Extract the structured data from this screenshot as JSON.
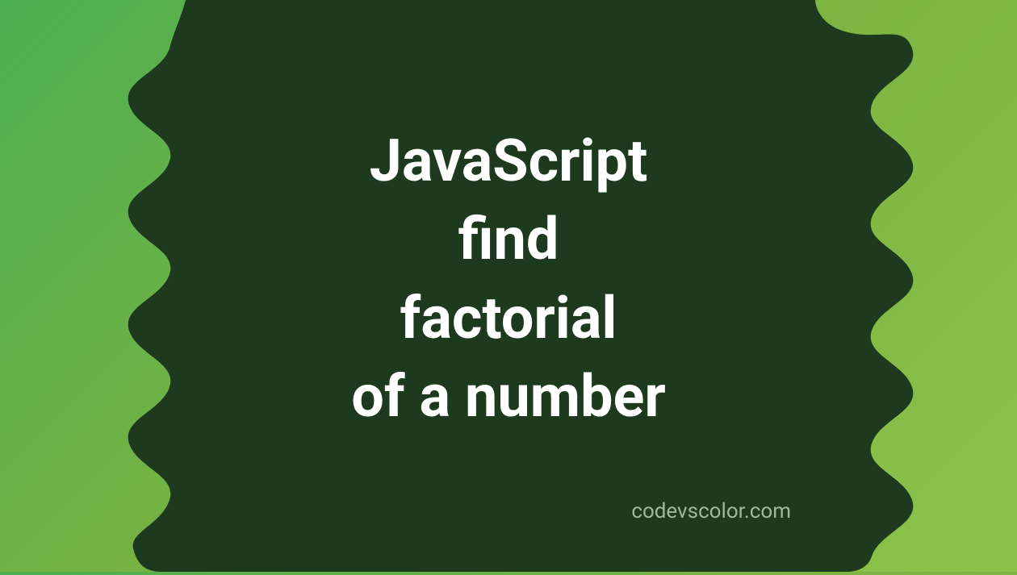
{
  "title": {
    "line1": "JavaScript",
    "line2": "find",
    "line3": "factorial",
    "line4": "of a number"
  },
  "attribution": "codevscolor.com",
  "colors": {
    "blob": "#1e3a1e",
    "text": "#ffffff",
    "attribution": "#9fb899",
    "bgStart": "#4caf50",
    "bgEnd": "#8bc34a"
  }
}
